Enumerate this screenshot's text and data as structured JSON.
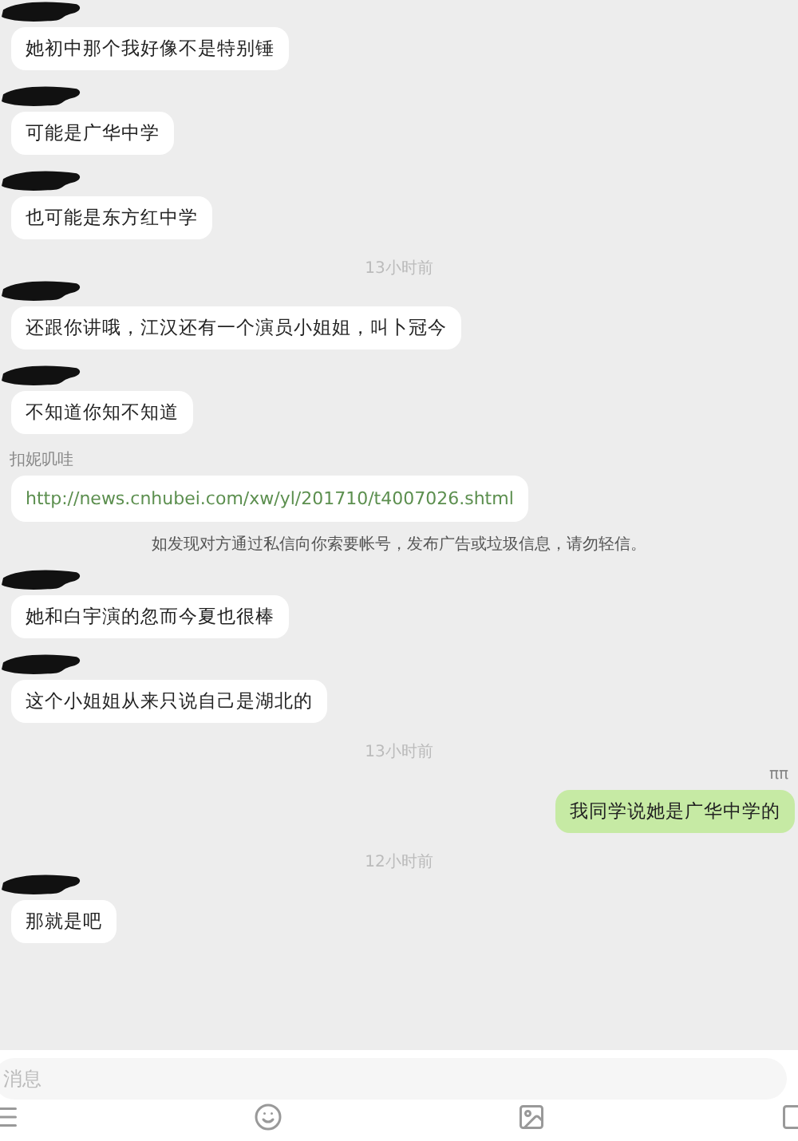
{
  "messages": [
    {
      "kind": "message",
      "outgoing": false,
      "sender_hidden": true,
      "text": "她初中那个我好像不是特别锤"
    },
    {
      "kind": "message",
      "outgoing": false,
      "sender_hidden": true,
      "text": "可能是广华中学"
    },
    {
      "kind": "message",
      "outgoing": false,
      "sender_hidden": true,
      "text": "也可能是东方红中学"
    },
    {
      "kind": "time",
      "text": "13小时前"
    },
    {
      "kind": "message",
      "outgoing": false,
      "sender_hidden": true,
      "text": "还跟你讲哦，江汉还有一个演员小姐姐，叫卜冠今"
    },
    {
      "kind": "message",
      "outgoing": false,
      "sender_hidden": true,
      "text": "不知道你知不知道"
    },
    {
      "kind": "link",
      "sender": "扣妮叽哇",
      "text": "http://news.cnhubei.com/xw/yl/201710/t4007026.shtml"
    },
    {
      "kind": "notice",
      "text": "如发现对方通过私信向你索要帐号，发布广告或垃圾信息，请勿轻信。"
    },
    {
      "kind": "message",
      "outgoing": false,
      "sender_hidden": true,
      "text": "她和白宇演的忽而今夏也很棒"
    },
    {
      "kind": "message",
      "outgoing": false,
      "sender_hidden": true,
      "text": "这个小姐姐从来只说自己是湖北的"
    },
    {
      "kind": "time",
      "text": "13小时前"
    },
    {
      "kind": "message",
      "outgoing": true,
      "sender": "ππ",
      "text": "我同学说她是广华中学的"
    },
    {
      "kind": "time",
      "text": "12小时前"
    },
    {
      "kind": "message",
      "outgoing": false,
      "sender_hidden": true,
      "text": "那就是吧"
    }
  ],
  "composer": {
    "placeholder": "消息"
  }
}
